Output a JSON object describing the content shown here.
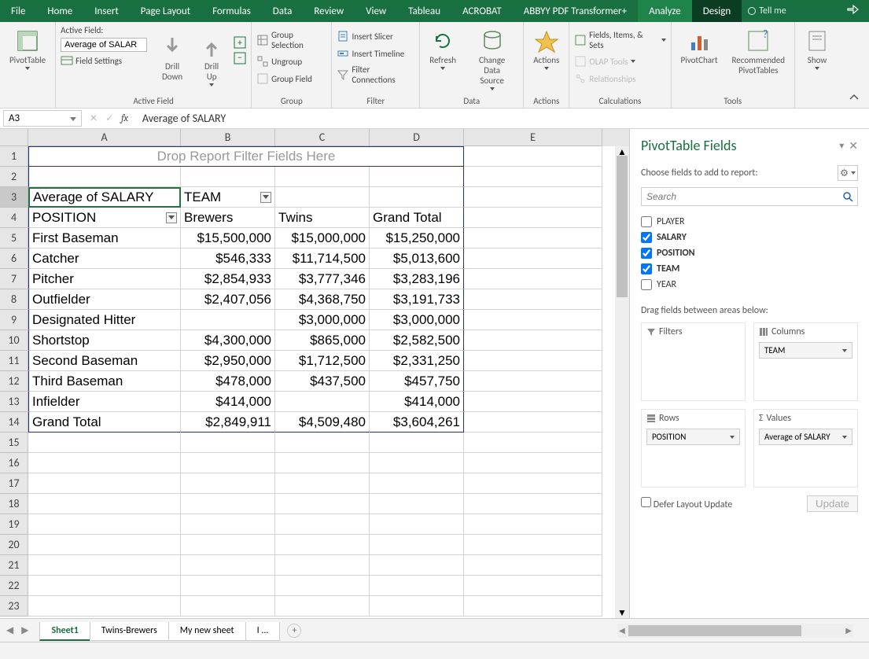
{
  "tabs": {
    "file": "File",
    "home": "Home",
    "insert": "Insert",
    "page_layout": "Page Layout",
    "formulas": "Formulas",
    "data": "Data",
    "review": "Review",
    "view": "View",
    "tableau": "Tableau",
    "acrobat": "ACROBAT",
    "abbyy": "ABBYY PDF Transformer+",
    "analyze": "Analyze",
    "design": "Design",
    "tell_me": "Tell me"
  },
  "ribbon": {
    "pivot_table": "PivotTable",
    "active_field_label": "Active Field:",
    "active_field_value": "Average of SALAR",
    "field_settings": "Field Settings",
    "drill_down": "Drill\nDown",
    "drill_up": "Drill\nUp",
    "group_label": "Group",
    "group_selection": "Group Selection",
    "ungroup": "Ungroup",
    "group_field": "Group Field",
    "filter_label": "Filter",
    "insert_slicer": "Insert Slicer",
    "insert_timeline": "Insert Timeline",
    "filter_connections": "Filter Connections",
    "data_label": "Data",
    "refresh": "Refresh",
    "change_data_source": "Change Data\nSource",
    "actions_label": "Actions",
    "actions": "Actions",
    "calc_label": "Calculations",
    "fields_items": "Fields, Items, & Sets",
    "olap_tools": "OLAP Tools",
    "relationships": "Relationships",
    "tools_label": "Tools",
    "pivot_chart": "PivotChart",
    "recommended": "Recommended\nPivotTables",
    "show": "Show",
    "active_field_group": "Active Field"
  },
  "name_box": "A3",
  "formula_bar": "Average of SALARY",
  "columns": [
    "A",
    "B",
    "C",
    "D",
    "E"
  ],
  "drop_hint": "Drop Report Filter Fields Here",
  "pivot": {
    "value_field": "Average of SALARY",
    "col_field": "TEAM",
    "row_field": "POSITION",
    "col_labels": [
      "Brewers",
      "Twins",
      "Grand Total"
    ],
    "rows": [
      {
        "label": "First Baseman",
        "b": "$15,500,000",
        "c": "$15,000,000",
        "d": "$15,250,000"
      },
      {
        "label": "Catcher",
        "b": "$546,333",
        "c": "$11,714,500",
        "d": "$5,013,600"
      },
      {
        "label": "Pitcher",
        "b": "$2,854,933",
        "c": "$3,777,346",
        "d": "$3,283,196"
      },
      {
        "label": "Outfielder",
        "b": "$2,407,056",
        "c": "$4,368,750",
        "d": "$3,191,733"
      },
      {
        "label": "Designated Hitter",
        "b": "",
        "c": "$3,000,000",
        "d": "$3,000,000"
      },
      {
        "label": "Shortstop",
        "b": "$4,300,000",
        "c": "$865,000",
        "d": "$2,582,500"
      },
      {
        "label": "Second Baseman",
        "b": "$2,950,000",
        "c": "$1,712,500",
        "d": "$2,331,250"
      },
      {
        "label": "Third Baseman",
        "b": "$478,000",
        "c": "$437,500",
        "d": "$457,750"
      },
      {
        "label": "Infielder",
        "b": "$414,000",
        "c": "",
        "d": "$414,000"
      }
    ],
    "grand_total": {
      "label": "Grand Total",
      "b": "$2,849,911",
      "c": "$4,509,480",
      "d": "$3,604,261"
    }
  },
  "field_pane": {
    "title": "PivotTable Fields",
    "subtitle": "Choose fields to add to report:",
    "search_placeholder": "Search",
    "fields": [
      {
        "name": "PLAYER",
        "checked": false
      },
      {
        "name": "SALARY",
        "checked": true
      },
      {
        "name": "POSITION",
        "checked": true
      },
      {
        "name": "TEAM",
        "checked": true
      },
      {
        "name": "YEAR",
        "checked": false
      }
    ],
    "drag_hint": "Drag fields between areas below:",
    "area_filters": "Filters",
    "area_columns": "Columns",
    "area_rows": "Rows",
    "area_values": "Values",
    "columns_pill": "TEAM",
    "rows_pill": "POSITION",
    "values_pill": "Average of SALARY",
    "defer": "Defer Layout Update",
    "update": "Update"
  },
  "sheets": {
    "active": "Sheet1",
    "tabs": [
      "Sheet1",
      "Twins-Brewers",
      "My new sheet",
      "I ..."
    ]
  }
}
